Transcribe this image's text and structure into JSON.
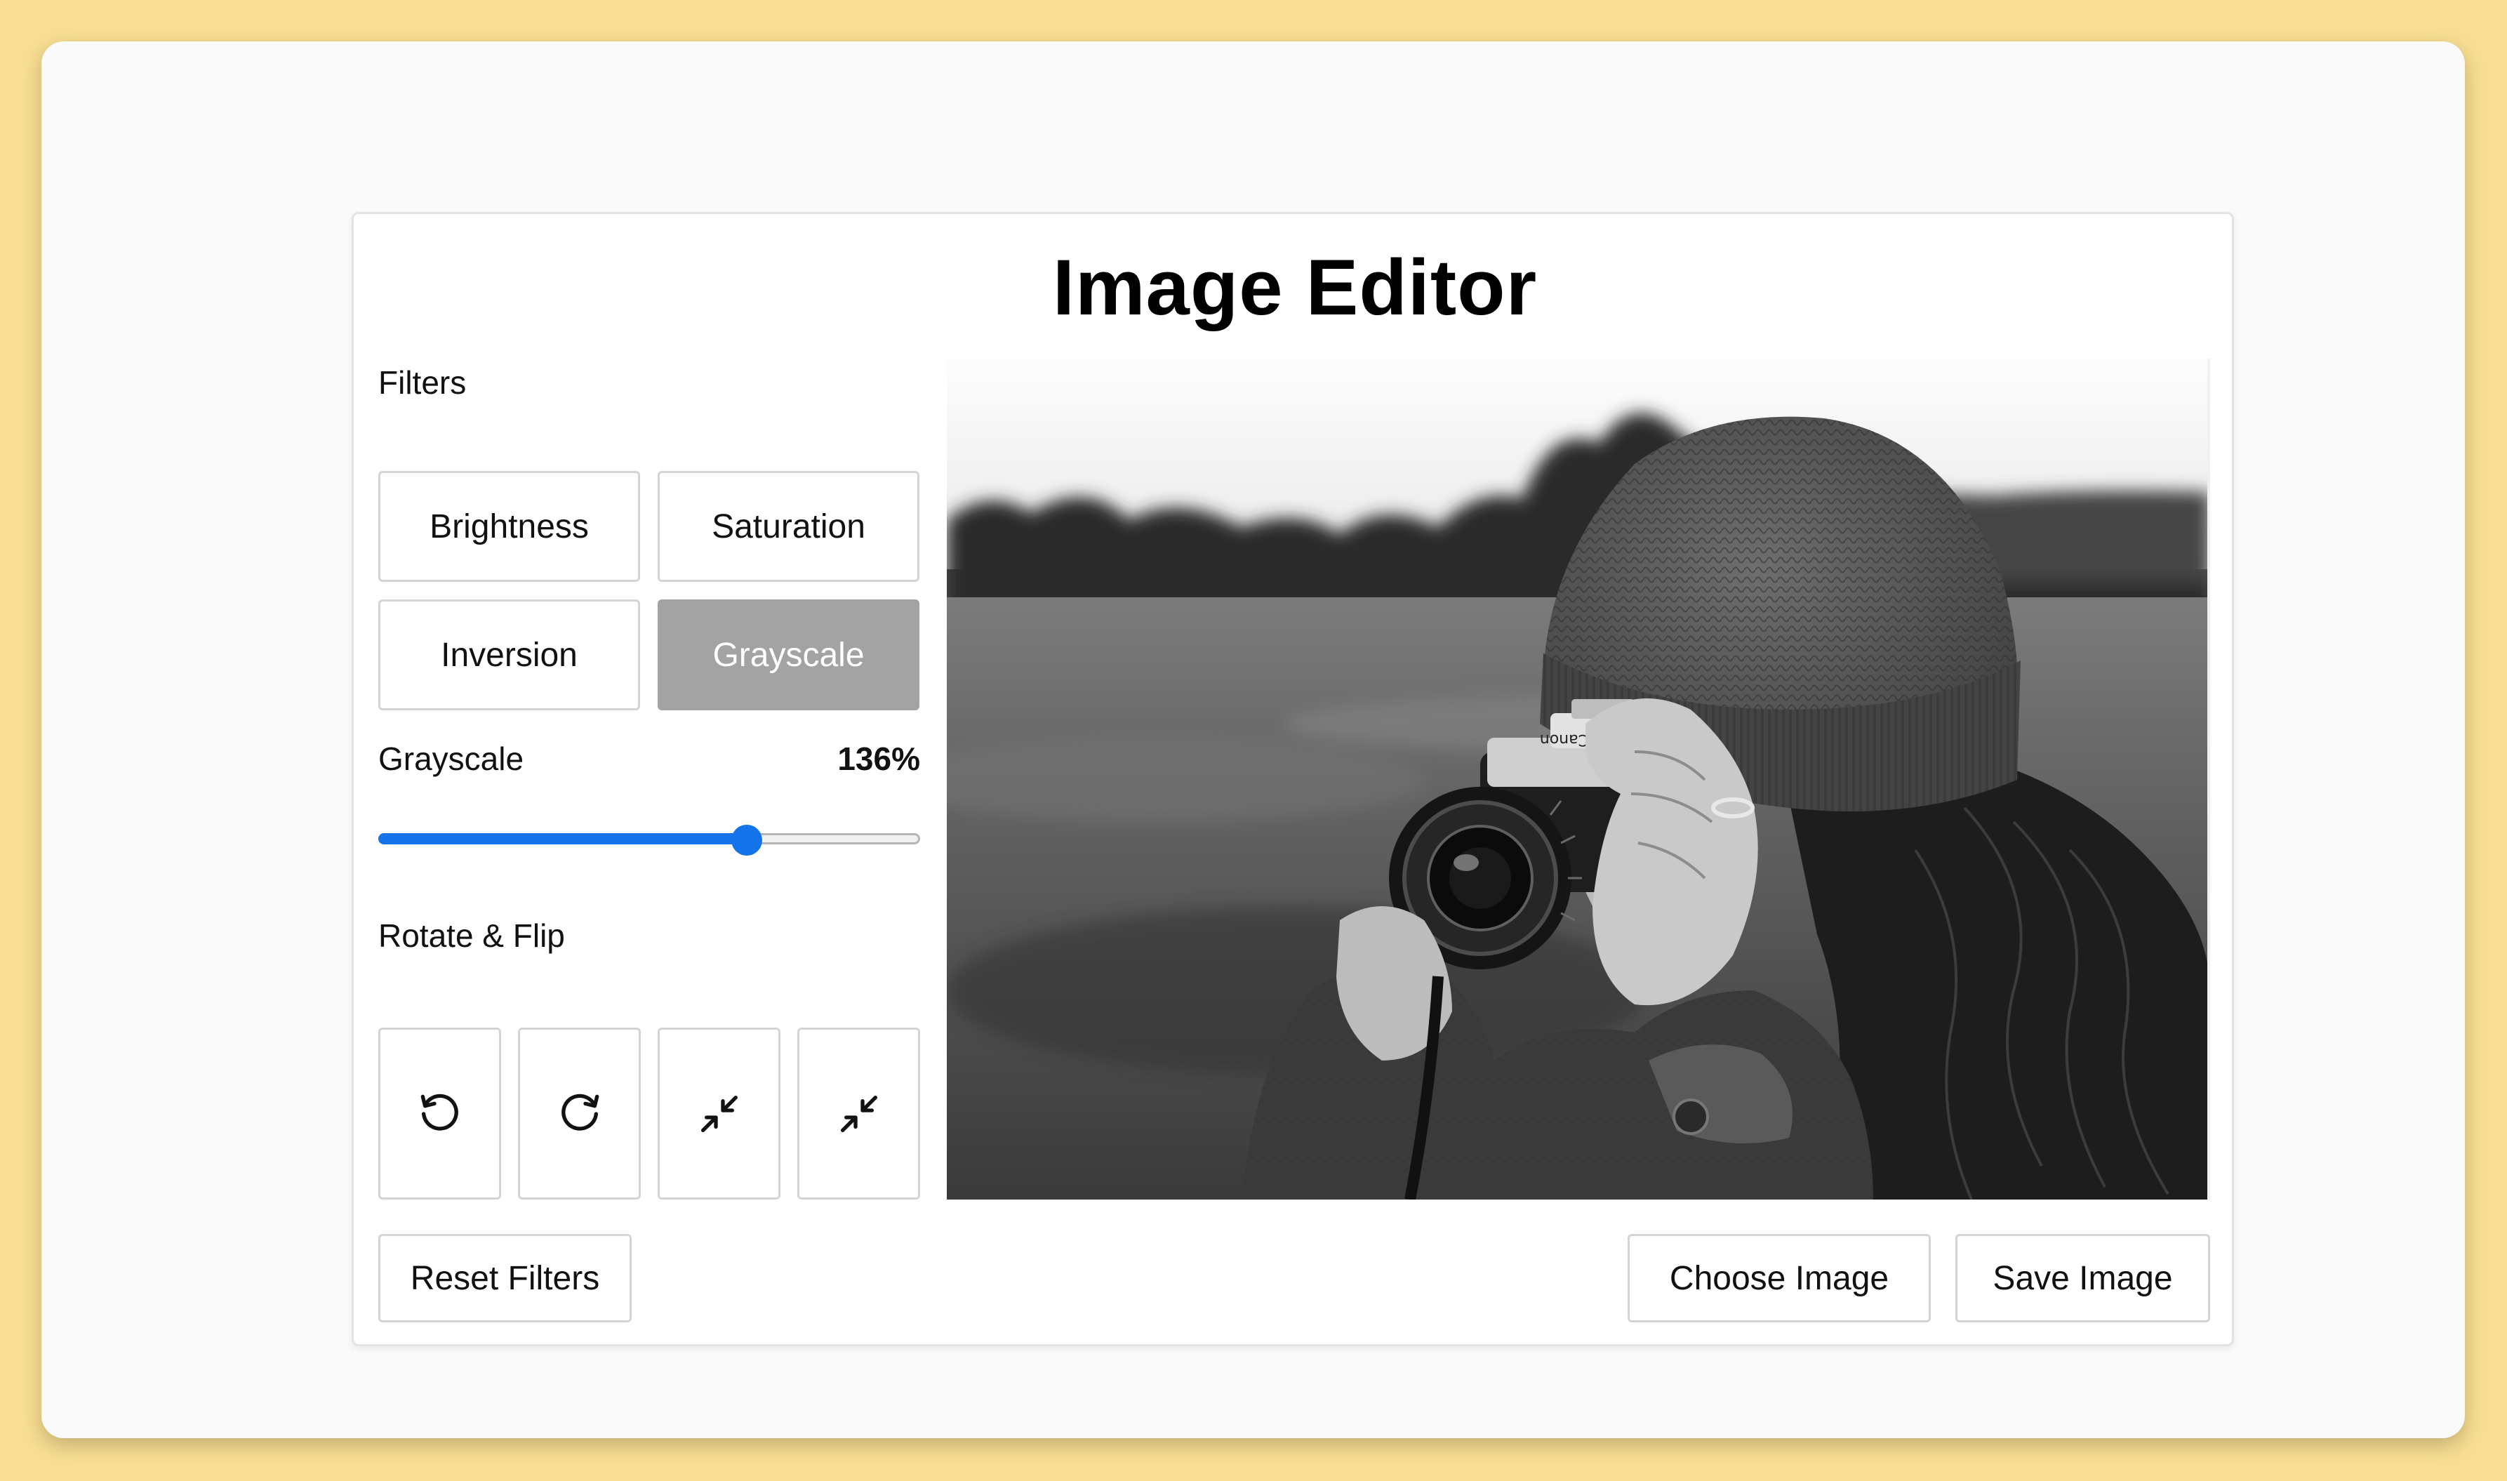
{
  "app": {
    "title": "Image Editor"
  },
  "filters": {
    "heading": "Filters",
    "options": [
      {
        "label": "Brightness",
        "active": false
      },
      {
        "label": "Saturation",
        "active": false
      },
      {
        "label": "Inversion",
        "active": false
      },
      {
        "label": "Grayscale",
        "active": true
      }
    ],
    "selected": {
      "name": "Grayscale",
      "value_text": "136%",
      "level": 0.68
    }
  },
  "rotate_flip": {
    "heading": "Rotate & Flip",
    "buttons": [
      {
        "icon": "rotate-left-icon"
      },
      {
        "icon": "rotate-right-icon"
      },
      {
        "icon": "flip-horizontal-icon"
      },
      {
        "icon": "flip-vertical-icon"
      }
    ]
  },
  "actions": {
    "reset_label": "Reset Filters",
    "choose_label": "Choose Image",
    "save_label": "Save Image"
  },
  "preview": {
    "description_icon": "photo-preview"
  },
  "colors": {
    "page_background": "#f8de92",
    "accent": "#1273ea",
    "active_filter": "#a3a3a3"
  }
}
